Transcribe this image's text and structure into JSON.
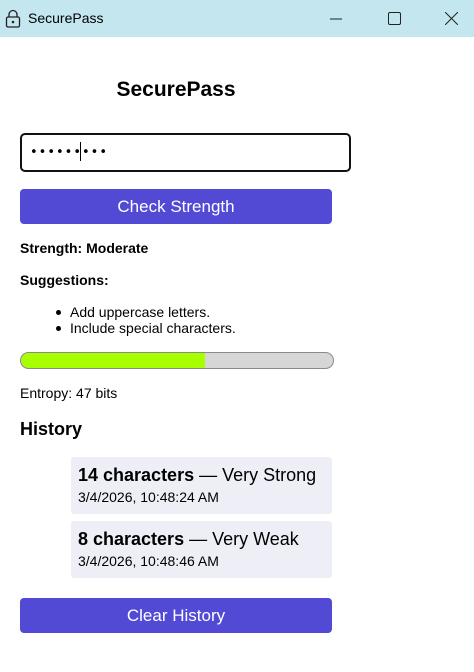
{
  "window": {
    "title": "SecurePass",
    "icon": "lock-icon",
    "controls": [
      "minimize-icon",
      "maximize-icon",
      "close-icon"
    ]
  },
  "app": {
    "heading": "SecurePass",
    "password_value": "•••••••••",
    "check_button": "Check Strength",
    "strength_text": "Strength: Moderate",
    "suggestions_title": "Suggestions:",
    "suggestions": [
      "Add uppercase letters.",
      "Include special characters."
    ],
    "strength_fraction": 0.59,
    "entropy_text": "Entropy: 47 bits",
    "history_title": "History",
    "history": [
      {
        "length": "14 characters",
        "rating": " — Very Strong",
        "timestamp": "3/4/2026, 10:48:24 AM"
      },
      {
        "length": "8 characters",
        "rating": " — Very Weak",
        "timestamp": "3/4/2026, 10:48:46 AM"
      }
    ],
    "clear_button": "Clear History"
  },
  "colors": {
    "titlebar": "#c3e6ef",
    "button": "#5249d5",
    "bar_fill": "#a8ff00",
    "bar_track": "#d6d6d6",
    "card": "#eeeef7"
  }
}
